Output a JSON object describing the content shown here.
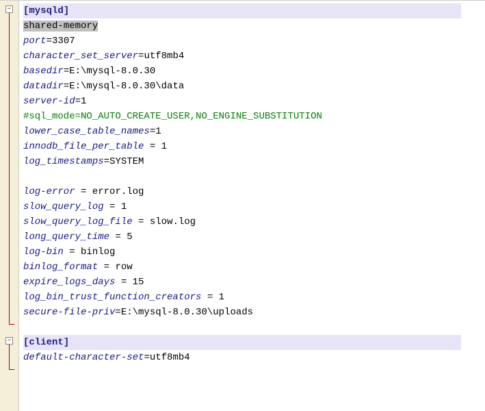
{
  "sections": {
    "mysqld": {
      "name": "mysqld",
      "lines": [
        {
          "type": "hl",
          "text": "shared-memory"
        },
        {
          "type": "kv",
          "key": "port",
          "val": "3307"
        },
        {
          "type": "kv",
          "key": "character_set_server",
          "val": "utf8mb4"
        },
        {
          "type": "kv",
          "key": "basedir",
          "val": "E:\\mysql-8.0.30"
        },
        {
          "type": "kv",
          "key": "datadir",
          "val": "E:\\mysql-8.0.30\\data"
        },
        {
          "type": "kv",
          "key": "server-id",
          "val": "1"
        },
        {
          "type": "comment",
          "text": "#sql_mode=NO_AUTO_CREATE_USER,NO_ENGINE_SUBSTITUTION"
        },
        {
          "type": "kv",
          "key": "lower_case_table_names",
          "val": "1"
        },
        {
          "type": "kvs",
          "key": "innodb_file_per_table",
          "val": "1"
        },
        {
          "type": "kv",
          "key": "log_timestamps",
          "val": "SYSTEM"
        },
        {
          "type": "blank"
        },
        {
          "type": "kvs",
          "key": "log-error",
          "val": "error.log"
        },
        {
          "type": "kvs",
          "key": "slow_query_log",
          "val": "1"
        },
        {
          "type": "kvs",
          "key": "slow_query_log_file",
          "val": "slow.log"
        },
        {
          "type": "kvs",
          "key": "long_query_time",
          "val": "5"
        },
        {
          "type": "kvs",
          "key": "log-bin",
          "val": "binlog"
        },
        {
          "type": "kvs",
          "key": "binlog_format",
          "val": "row"
        },
        {
          "type": "kvs",
          "key": "expire_logs_days",
          "val": "15"
        },
        {
          "type": "kvs",
          "key": "log_bin_trust_function_creators",
          "val": "1"
        },
        {
          "type": "kv",
          "key": "secure-file-priv",
          "val": "E:\\mysql-8.0.30\\uploads"
        }
      ]
    },
    "client": {
      "name": "client",
      "lines": [
        {
          "type": "kv",
          "key": "default-character-set",
          "val": "utf8mb4"
        }
      ]
    }
  },
  "foldSymbol": "−"
}
